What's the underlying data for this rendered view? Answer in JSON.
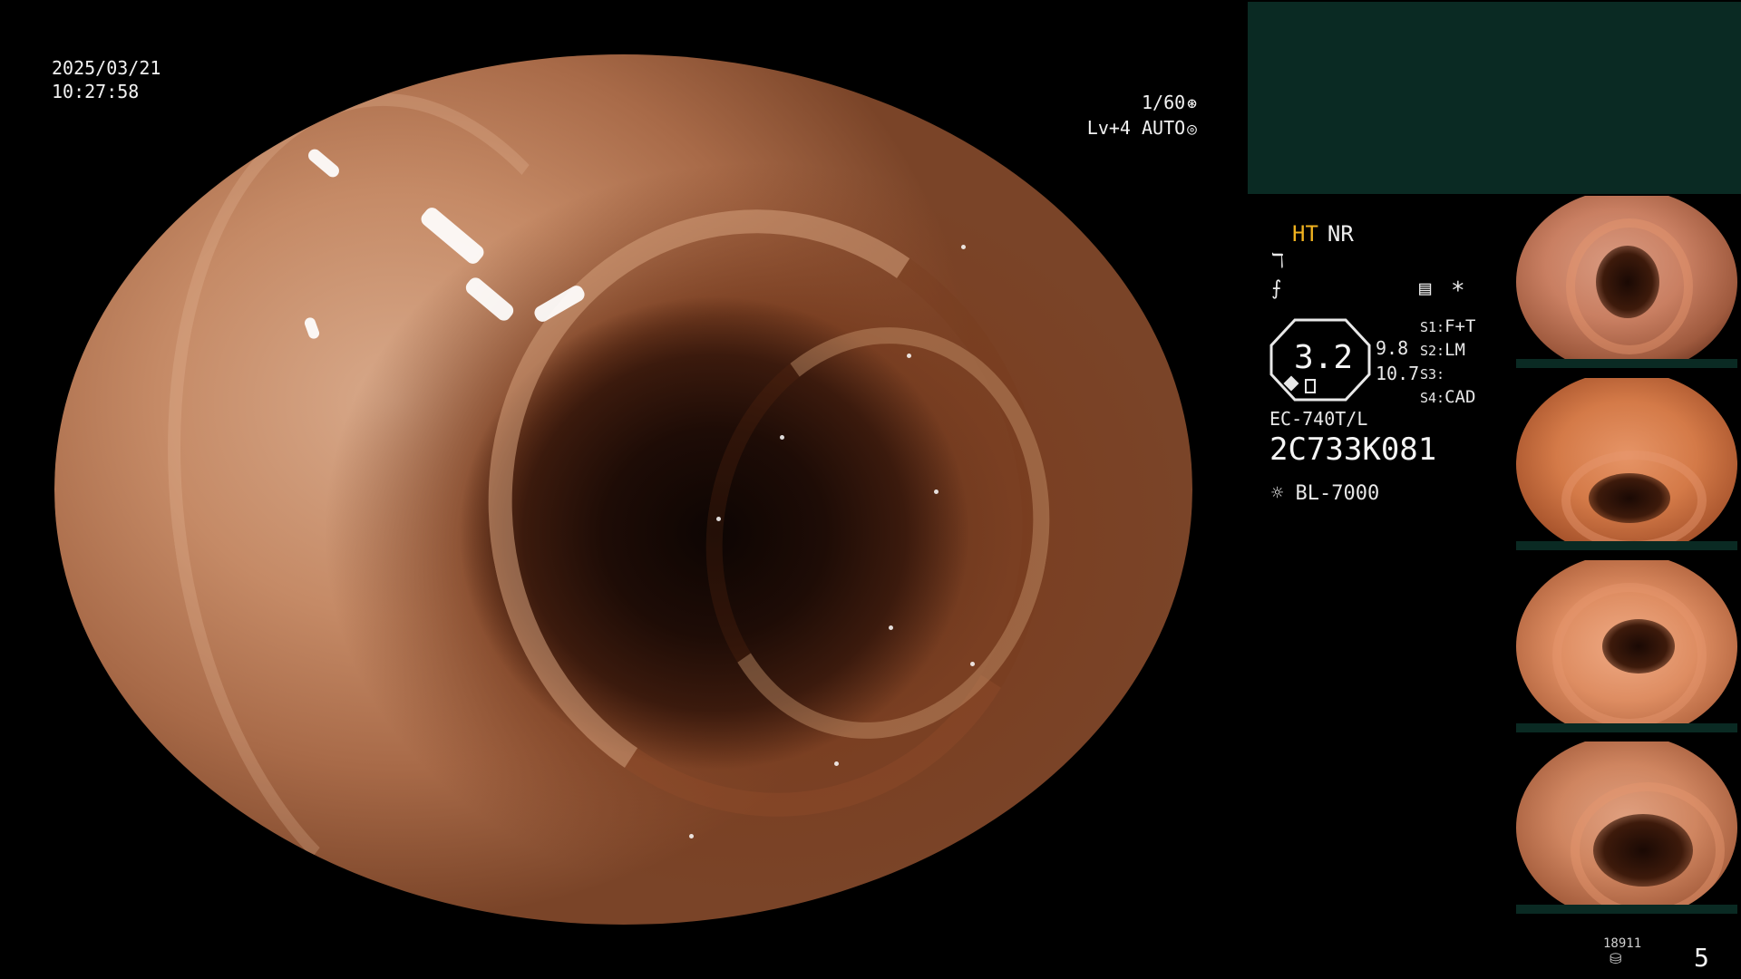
{
  "overlay": {
    "date": "2025/03/21",
    "time": "10:27:58",
    "shutter": "1/60",
    "shutter_icon": "aperture-icon",
    "level": "Lv+4 AUTO",
    "level_icon": "iris-icon"
  },
  "panel": {
    "mode_ht": "HT",
    "mode_nr": "NR",
    "icon1": "edge-enhance-icon",
    "icon2": "contrast-icon",
    "zoom": "3.2",
    "zoom_side_top": "9.8",
    "zoom_side_bottom": "10.7",
    "doc_icon": "document-icon",
    "star": "*",
    "s_lines": [
      {
        "key": "S1:",
        "value": "F+T"
      },
      {
        "key": "S2:",
        "value": "LM"
      },
      {
        "key": "S3:",
        "value": ""
      },
      {
        "key": "S4:",
        "value": "CAD"
      }
    ],
    "scope_model": "EC-740T/L",
    "scope_serial": "2C733K081",
    "light_icon": "sun-icon",
    "light_source": "BL-7000"
  },
  "footer": {
    "capture_id": "18911",
    "capture_icon": "disk-icon",
    "capture_count": "5"
  },
  "colors": {
    "accent_yellow": "#f0b21f",
    "panel_green": "#0a2a23"
  }
}
